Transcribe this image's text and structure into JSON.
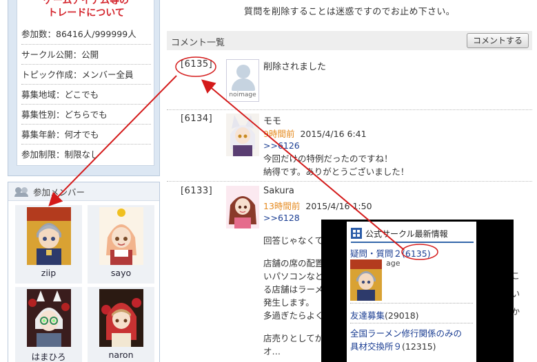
{
  "circle_info": {
    "title_line1": "ゲームアイテム等の",
    "title_line2": "トレードについて",
    "rows": [
      "参加数：86416人/999999人",
      "サークル公開：公開",
      "トピック作成：メンバー全員",
      "募集地域：どこでも",
      "募集性別：どちらでも",
      "募集年齢：何才でも",
      "参加制限：制限なし"
    ]
  },
  "members": {
    "header": "参加メンバー",
    "items": [
      {
        "name": "ziip"
      },
      {
        "name": "sayo"
      },
      {
        "name": "はまひろ"
      },
      {
        "name": "naron"
      }
    ]
  },
  "notice": "質問を削除することは迷惑ですのでお止め下さい。",
  "comments_section": {
    "title": "コメント一覧",
    "button": "コメントする"
  },
  "comments": [
    {
      "num": "[6135]",
      "name": "削除されました",
      "noimage": "noimage"
    },
    {
      "num": "[6134]",
      "name": "モモ",
      "ago": "9時間前",
      "date": "2015/4/16 6:41",
      "ref": ">>6126",
      "line1": "今回だけの特例だったのですね！",
      "line2": "納得です。ありがとうございました！"
    },
    {
      "num": "[6133]",
      "name": "Sakura",
      "ago": "13時間前",
      "date": "2015/4/16 1:50",
      "ref": ">>6128",
      "line1": "回答じゃなくて",
      "line2": "店舗の席の配置",
      "line3": "いパソコンなど",
      "line4": "る店舗はラーメ",
      "line5": "発生します。",
      "line6": "多過ぎたらよく",
      "line7": "店売りとしてか",
      "line8": "オ…"
    }
  ],
  "right_cut": {
    "a": "こ",
    "b": "い",
    "c": "か"
  },
  "popup": {
    "header": "公式サークル最新情報",
    "row1_prefix": "疑問・質問２",
    "row1_num": "(6135)",
    "age": "age",
    "row2_label": "友達募集",
    "row2_count": "(29018)",
    "row3_label_a": "全国ラーメン修行関係のみの",
    "row3_label_b": "具材交換所９",
    "row3_count": "(12315)"
  },
  "colors": {
    "accent_red": "#d4262e",
    "link_blue": "#1a3d92",
    "time_orange": "#e58a1e"
  }
}
